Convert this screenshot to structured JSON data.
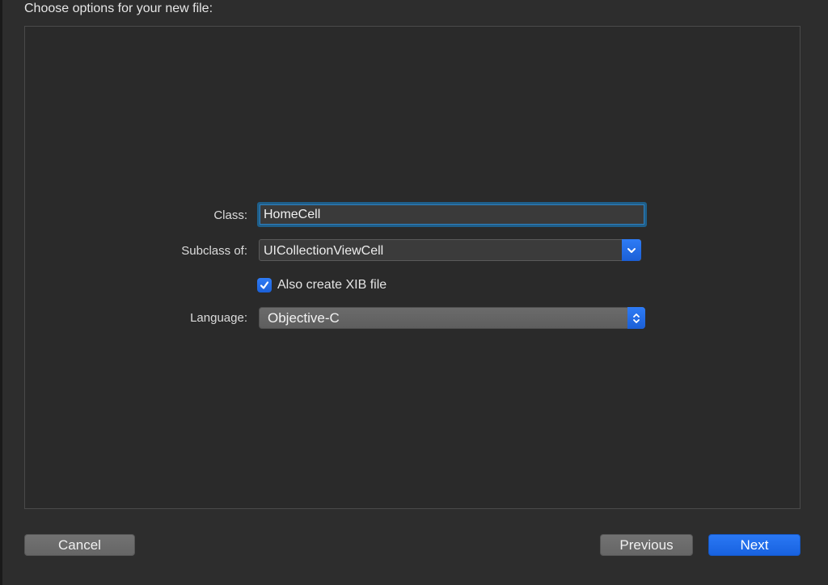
{
  "dialog": {
    "title": "Choose options for your new file:"
  },
  "form": {
    "class_label": "Class:",
    "class_value": "HomeCell",
    "subclass_label": "Subclass of:",
    "subclass_value": "UICollectionViewCell",
    "xib_checkbox_label": "Also create XIB file",
    "xib_checked": true,
    "language_label": "Language:",
    "language_value": "Objective-C"
  },
  "buttons": {
    "cancel": "Cancel",
    "previous": "Previous",
    "next": "Next"
  },
  "icons": {
    "combo_dropdown": "chevron-down-icon",
    "popup_stepper": "updown-chevrons-icon",
    "checkbox": "checkmark-icon"
  },
  "colors": {
    "accent": "#1b6ae4",
    "background": "#2d2d2d",
    "focus_ring": "#1f5f8a"
  }
}
